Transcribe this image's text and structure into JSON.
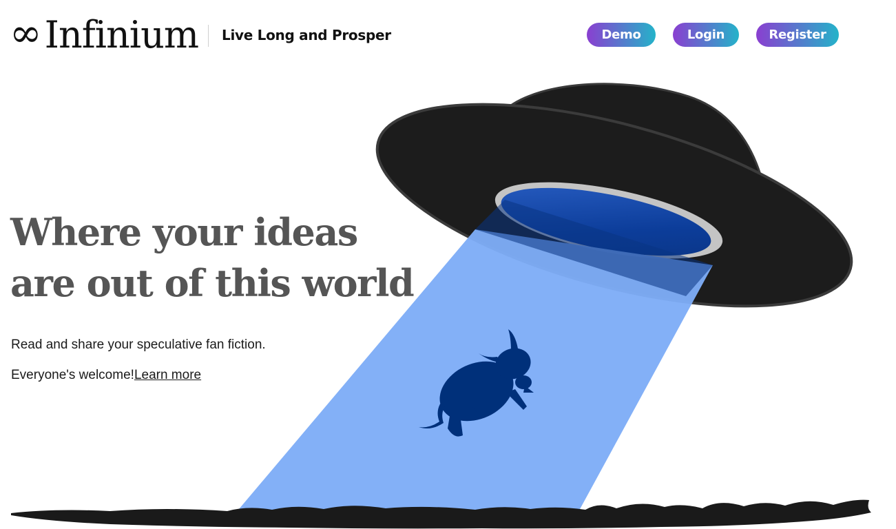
{
  "header": {
    "logo_symbol": "∞",
    "logo_text": "Infinium",
    "tagline": "Live Long and Prosper",
    "nav": {
      "demo_label": "Demo",
      "login_label": "Login",
      "register_label": "Register"
    }
  },
  "hero": {
    "title_line1": "Where your ideas",
    "title_line2": "are out of this world",
    "subtitle": "Read and share your speculative fan fiction.",
    "welcome_text": "Everyone's welcome!",
    "learn_more_label": "Learn more"
  },
  "colors": {
    "button_gradient_start": "#8a3fd0",
    "button_gradient_end": "#24b3c9",
    "beam": "#7eadf7",
    "cow": "#00307a",
    "ufo_body": "#1c1c1c",
    "title_text": "#555555"
  },
  "illustration": {
    "icons": [
      "ufo-icon",
      "tractor-beam",
      "cow-icon",
      "ground-silhouette"
    ]
  }
}
